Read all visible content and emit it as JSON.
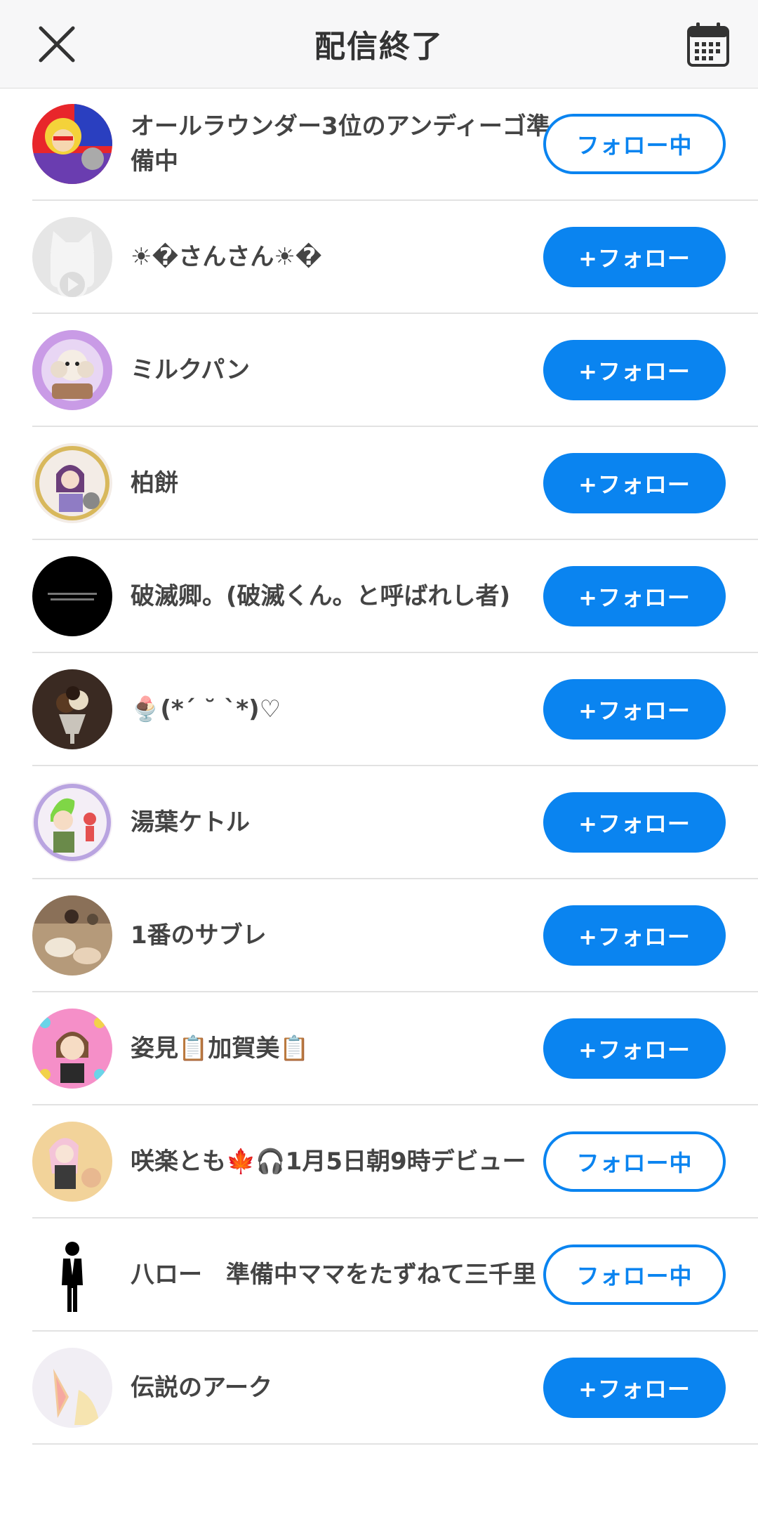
{
  "header": {
    "title": "配信終了",
    "close_icon": "close-icon",
    "calendar_icon": "calendar-icon"
  },
  "colors": {
    "accent": "#0a84f0",
    "divider": "#e2e2e2",
    "header_bg": "#f7f7f8"
  },
  "users": [
    {
      "name": "オールラウンダー3位のアンディーゴ準備中",
      "button": "フォロー中",
      "state": "following"
    },
    {
      "name": "☀︎�さんさん☀︎�",
      "button": "+フォロー",
      "state": "follow"
    },
    {
      "name": "ミルクパン",
      "button": "+フォロー",
      "state": "follow"
    },
    {
      "name": "柏餅",
      "button": "+フォロー",
      "state": "follow"
    },
    {
      "name": "破滅卿。(破滅くん。と呼ばれし者)",
      "button": "+フォロー",
      "state": "follow"
    },
    {
      "name": "🍨(*´ ˘ `*)♡",
      "button": "+フォロー",
      "state": "follow"
    },
    {
      "name": "湯葉ケトル",
      "button": "+フォロー",
      "state": "follow"
    },
    {
      "name": "1番のサブレ",
      "button": "+フォロー",
      "state": "follow"
    },
    {
      "name": "姿見📋加賀美📋",
      "button": "+フォロー",
      "state": "follow"
    },
    {
      "name": "咲楽とも🍁🎧1月5日朝9時デビュー",
      "button": "フォロー中",
      "state": "following"
    },
    {
      "name": "八ロー　準備中ママをたずねて三千里",
      "button": "フォロー中",
      "state": "following"
    },
    {
      "name": "伝説のアーク",
      "button": "+フォロー",
      "state": "follow"
    }
  ]
}
